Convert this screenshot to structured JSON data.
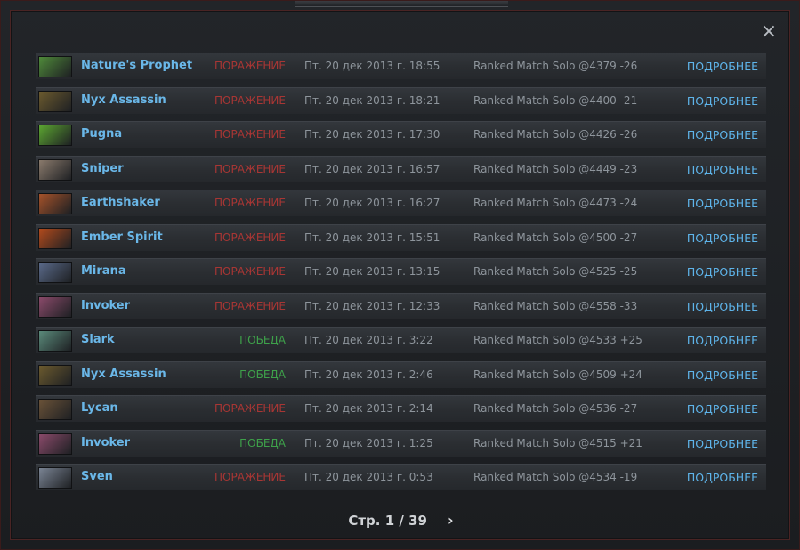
{
  "close_icon": "×",
  "matches": [
    {
      "hero": "Nature's Prophet",
      "result": "ПОРАЖЕНИЕ",
      "outcome": "loss",
      "date": "Пт. 20 дек 2013 г. 18:55",
      "mode": "Ranked Match Solo @4379 -26",
      "details": "ПОДРОБНЕЕ",
      "color": "#4f8a3a"
    },
    {
      "hero": "Nyx Assassin",
      "result": "ПОРАЖЕНИЕ",
      "outcome": "loss",
      "date": "Пт. 20 дек 2013 г. 18:21",
      "mode": "Ranked Match Solo @4400 -21",
      "details": "ПОДРОБНЕЕ",
      "color": "#6b5a2e"
    },
    {
      "hero": "Pugna",
      "result": "ПОРАЖЕНИЕ",
      "outcome": "loss",
      "date": "Пт. 20 дек 2013 г. 17:30",
      "mode": "Ranked Match Solo @4426 -26",
      "details": "ПОДРОБНЕЕ",
      "color": "#5ba531"
    },
    {
      "hero": "Sniper",
      "result": "ПОРАЖЕНИЕ",
      "outcome": "loss",
      "date": "Пт. 20 дек 2013 г. 16:57",
      "mode": "Ranked Match Solo @4449 -23",
      "details": "ПОДРОБНЕЕ",
      "color": "#8a7a6c"
    },
    {
      "hero": "Earthshaker",
      "result": "ПОРАЖЕНИЕ",
      "outcome": "loss",
      "date": "Пт. 20 дек 2013 г. 16:27",
      "mode": "Ranked Match Solo @4473 -24",
      "details": "ПОДРОБНЕЕ",
      "color": "#a5522a"
    },
    {
      "hero": "Ember Spirit",
      "result": "ПОРАЖЕНИЕ",
      "outcome": "loss",
      "date": "Пт. 20 дек 2013 г. 15:51",
      "mode": "Ranked Match Solo @4500 -27",
      "details": "ПОДРОБНЕЕ",
      "color": "#b24a1c"
    },
    {
      "hero": "Mirana",
      "result": "ПОРАЖЕНИЕ",
      "outcome": "loss",
      "date": "Пт. 20 дек 2013 г. 13:15",
      "mode": "Ranked Match Solo @4525 -25",
      "details": "ПОДРОБНЕЕ",
      "color": "#5a6a8a"
    },
    {
      "hero": "Invoker",
      "result": "ПОРАЖЕНИЕ",
      "outcome": "loss",
      "date": "Пт. 20 дек 2013 г. 12:33",
      "mode": "Ranked Match Solo @4558 -33",
      "details": "ПОДРОБНЕЕ",
      "color": "#8a4a6a"
    },
    {
      "hero": "Slark",
      "result": "ПОБЕДА",
      "outcome": "win",
      "date": "Пт. 20 дек 2013 г. 3:22",
      "mode": "Ranked Match Solo @4533 +25",
      "details": "ПОДРОБНЕЕ",
      "color": "#5a8a7a"
    },
    {
      "hero": "Nyx Assassin",
      "result": "ПОБЕДА",
      "outcome": "win",
      "date": "Пт. 20 дек 2013 г. 2:46",
      "mode": "Ranked Match Solo @4509 +24",
      "details": "ПОДРОБНЕЕ",
      "color": "#6b5a2e"
    },
    {
      "hero": "Lycan",
      "result": "ПОРАЖЕНИЕ",
      "outcome": "loss",
      "date": "Пт. 20 дек 2013 г. 2:14",
      "mode": "Ranked Match Solo @4536 -27",
      "details": "ПОДРОБНЕЕ",
      "color": "#6a5238"
    },
    {
      "hero": "Invoker",
      "result": "ПОБЕДА",
      "outcome": "win",
      "date": "Пт. 20 дек 2013 г. 1:25",
      "mode": "Ranked Match Solo @4515 +21",
      "details": "ПОДРОБНЕЕ",
      "color": "#8a4a6a"
    },
    {
      "hero": "Sven",
      "result": "ПОРАЖЕНИЕ",
      "outcome": "loss",
      "date": "Пт. 20 дек 2013 г. 0:53",
      "mode": "Ranked Match Solo @4534 -19",
      "details": "ПОДРОБНЕЕ",
      "color": "#7a8494"
    }
  ],
  "pager": {
    "label": "Стр. 1 / 39",
    "next_icon": "›"
  }
}
